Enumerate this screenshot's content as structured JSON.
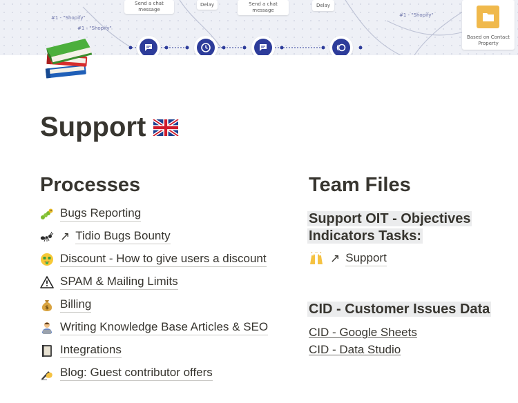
{
  "cover": {
    "card_labels": [
      "Send a chat message",
      "Delay",
      "Send a chat message",
      "Delay"
    ],
    "tags": [
      "#1 - \"Shopify\"",
      "#1 - \"Shopify\"",
      "#1 - \"Shopify\""
    ],
    "folder_label": "Based on Contact Property",
    "node_icons": [
      "chat-icon",
      "clock-icon",
      "chat-icon",
      "ring-icon"
    ],
    "accent": "#2d3c9a",
    "folder_color": "#f0b94c"
  },
  "page": {
    "icon": "books-icon",
    "title": "Support",
    "title_icon": "uk-flag-icon"
  },
  "processes": {
    "heading": "Processes",
    "items": [
      {
        "icon": "caterpillar-icon",
        "label": "Bugs Reporting",
        "external": false
      },
      {
        "icon": "ant-icon",
        "label": "Tidio Bugs Bounty",
        "external": true
      },
      {
        "icon": "money-face-icon",
        "label": "Discount - How to give users a discount",
        "external": false
      },
      {
        "icon": "warning-icon",
        "label": "SPAM & Mailing Limits",
        "external": false
      },
      {
        "icon": "money-bag-icon",
        "label": "Billing",
        "external": false
      },
      {
        "icon": "technologist-icon",
        "label": "Writing Knowledge Base Articles & SEO",
        "external": false
      },
      {
        "icon": "notebook-icon",
        "label": "Integrations",
        "external": false
      },
      {
        "icon": "writing-hand-icon",
        "label": "Blog: Guest contributor offers",
        "external": false
      }
    ]
  },
  "team_files": {
    "heading": "Team Files",
    "oit_heading_line1": "Support OIT - Objectives",
    "oit_heading_line2": "Indicators Tasks:",
    "support_link": "Support",
    "cid_heading": "CID - Customer Issues Data",
    "cid_links": [
      "CID - Google Sheets",
      "CID - Data Studio"
    ]
  }
}
